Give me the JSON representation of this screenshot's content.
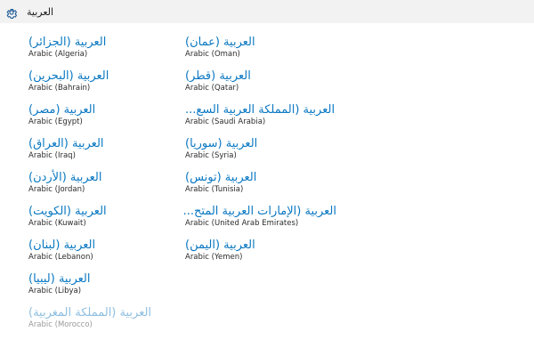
{
  "header": {
    "title": "العربية",
    "icon": "gear-icon"
  },
  "languages_left": [
    {
      "native": "العربية (الجزائر)",
      "english": "Arabic (Algeria)"
    },
    {
      "native": "العربية (البحرين)",
      "english": "Arabic (Bahrain)"
    },
    {
      "native": "العربية (مصر)",
      "english": "Arabic (Egypt)"
    },
    {
      "native": "العربية (العراق)",
      "english": "Arabic (Iraq)"
    },
    {
      "native": "العربية (الأردن)",
      "english": "Arabic (Jordan)"
    },
    {
      "native": "العربية (الكويت)",
      "english": "Arabic (Kuwait)"
    },
    {
      "native": "العربية (لبنان)",
      "english": "Arabic (Lebanon)"
    },
    {
      "native": "العربية (ليبيا)",
      "english": "Arabic (Libya)"
    },
    {
      "native": "العربية (المملكة المغربية)",
      "english": "Arabic (Morocco)",
      "state": "disabled"
    }
  ],
  "languages_right": [
    {
      "native": "العربية (عمان)",
      "english": "Arabic (Oman)"
    },
    {
      "native": "العربية (قطر)",
      "english": "Arabic (Qatar)"
    },
    {
      "native": "العربية (المملكة العربية السع...",
      "english": "Arabic (Saudi Arabia)"
    },
    {
      "native": "العربية (سوريا)",
      "english": "Arabic (Syria)"
    },
    {
      "native": "العربية (تونس)",
      "english": "Arabic (Tunisia)"
    },
    {
      "native": "العربية (الإمارات العربية المتح...",
      "english": "Arabic (United Arab Emirates)"
    },
    {
      "native": "العربية (اليمن)",
      "english": "Arabic (Yemen)"
    }
  ],
  "colors": {
    "accent": "#0a78c2",
    "accent_disabled": "#8fbfe0",
    "header_bg": "#f2f2f2"
  }
}
